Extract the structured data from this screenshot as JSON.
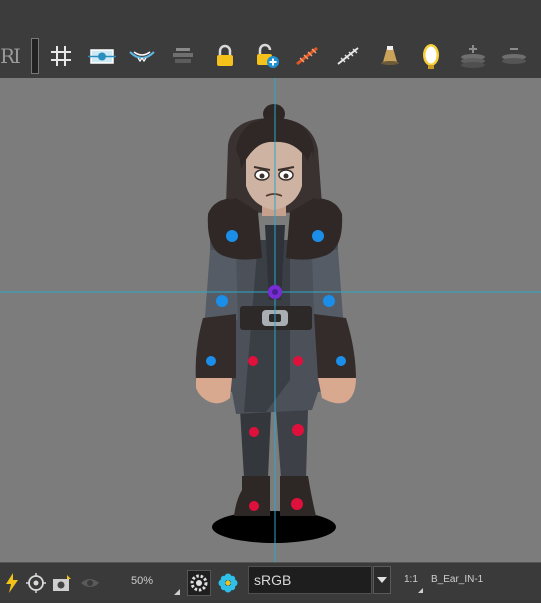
{
  "toolbar": {
    "text_tool_label": "RI",
    "buttons": [
      {
        "name": "grid-button",
        "icon": "grid-icon"
      },
      {
        "name": "camera-mask-button",
        "icon": "camera-mask-icon"
      },
      {
        "name": "onion-skin-button",
        "icon": "onion-skin-icon"
      },
      {
        "name": "light-table-button",
        "icon": "light-table-icon"
      },
      {
        "name": "lock-button",
        "icon": "lock-icon"
      },
      {
        "name": "unlock-add-button",
        "icon": "unlock-add-icon"
      },
      {
        "name": "bone-red-button",
        "icon": "bone-red-icon"
      },
      {
        "name": "bone-white-button",
        "icon": "bone-white-icon"
      },
      {
        "name": "spotlight-button",
        "icon": "spotlight-icon"
      },
      {
        "name": "mirror-button",
        "icon": "mirror-icon"
      },
      {
        "name": "add-layer-button",
        "icon": "add-layer-icon"
      },
      {
        "name": "remove-layer-button",
        "icon": "remove-layer-icon"
      }
    ]
  },
  "statusbar": {
    "zoom": "50%",
    "color_space": "sRGB",
    "ratio": "1:1",
    "current_layer": "B_Ear_IN-1"
  },
  "colors": {
    "toolbar_bg": "#3c3c3c",
    "viewport_bg": "#7c7c7c",
    "guide_line": "#2aa7c9",
    "pivot_blue": "#1a8ee8",
    "pivot_red": "#e0103c",
    "pivot_purple": "#7a2bd6"
  }
}
